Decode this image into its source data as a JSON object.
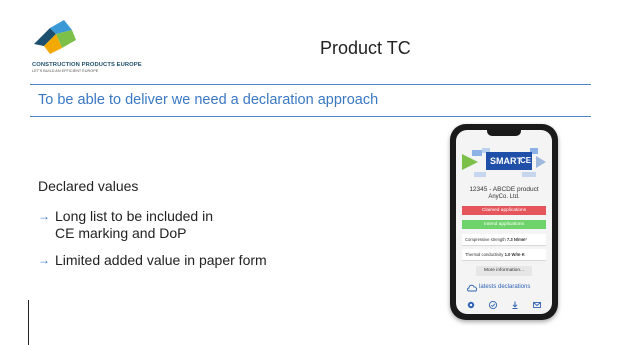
{
  "header": {
    "logo_name": "CONSTRUCTION PRODUCTS EUROPE",
    "logo_tagline": "LET'S BUILD AN EFFICIENT EUROPE",
    "title": "Product TC"
  },
  "subtitle": "To be able to deliver we need a declaration approach",
  "body": {
    "heading": "Declared values",
    "bullets": [
      {
        "line1": "Long list to be included in",
        "line2": "CE marking and DoP"
      },
      {
        "line1": "Limited added value in paper form"
      }
    ]
  },
  "phone": {
    "logo_text": "SMART",
    "logo_ce": "CE",
    "product_name": "12345 - ABCDE product",
    "company": "AnyCo. Ltd.",
    "bar_red": "Claimed applications",
    "bar_green": "Intend applications",
    "rows": [
      {
        "label": "Compressive strength ",
        "value": "7.3 N/mm²"
      },
      {
        "label": "Thermal conductivity ",
        "value": "1.0 W/m·K"
      }
    ],
    "more_button": "More information...",
    "latest": "latests declarations"
  },
  "colors": {
    "accent_blue": "#3a78c2",
    "rule_blue": "#4a8ac8",
    "bar_red": "#e4565b",
    "bar_green": "#6fd36b"
  }
}
